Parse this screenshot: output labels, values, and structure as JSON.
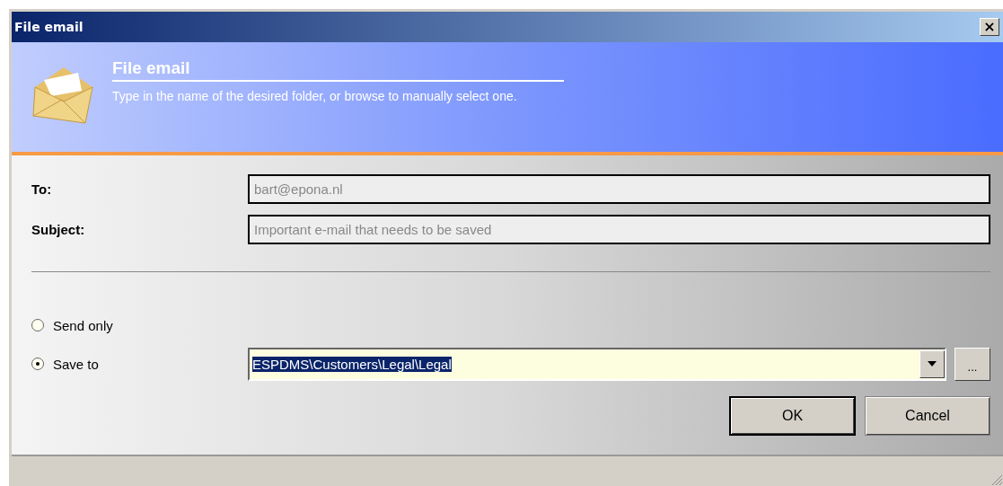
{
  "window": {
    "title": "File email",
    "close": "×"
  },
  "header": {
    "title": "File email",
    "description": "Type in the name of the desired folder, or browse to manually select one."
  },
  "fields": [
    {
      "label": "To:",
      "value": "bart@epona.nl",
      "disabled": true
    },
    {
      "label": "Subject:",
      "value": "Important e-mail that needs to be saved",
      "disabled": true
    }
  ],
  "options": [
    {
      "label": "Send only",
      "selected": false
    },
    {
      "label": "Save to",
      "selected": true
    }
  ],
  "save_to": {
    "value": "ESPDMS\\Customers\\Legal\\Legal",
    "browse": "..."
  },
  "buttons": [
    "OK",
    "Cancel"
  ]
}
